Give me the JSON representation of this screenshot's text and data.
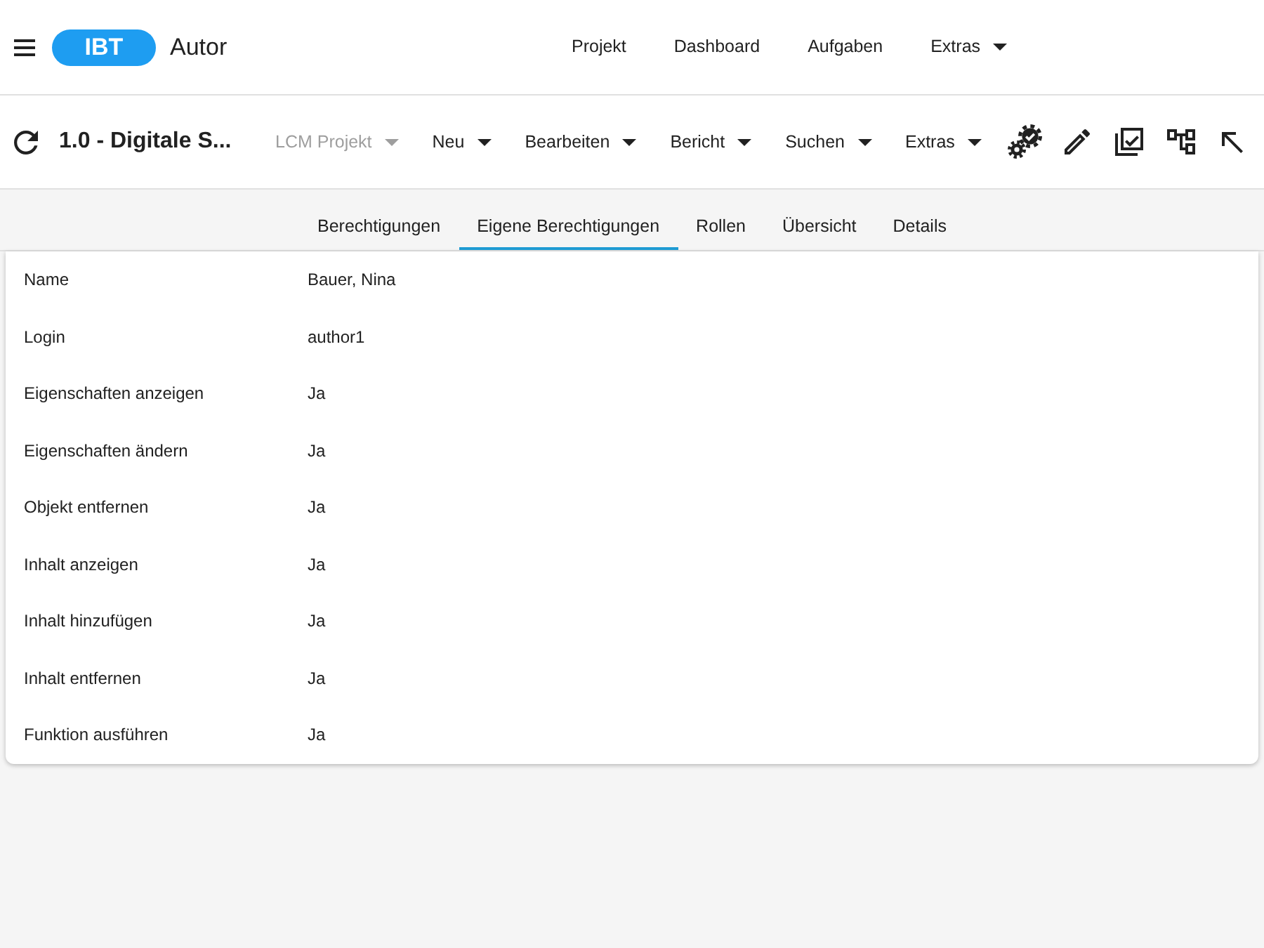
{
  "header": {
    "logo": "IBT",
    "app_title": "Autor",
    "nav": [
      {
        "label": "Projekt",
        "dropdown": false
      },
      {
        "label": "Dashboard",
        "dropdown": false
      },
      {
        "label": "Aufgaben",
        "dropdown": false
      },
      {
        "label": "Extras",
        "dropdown": true
      }
    ]
  },
  "toolbar": {
    "title": "1.0 - Digitale S...",
    "menus": [
      {
        "label": "LCM Projekt",
        "disabled": true
      },
      {
        "label": "Neu",
        "disabled": false
      },
      {
        "label": "Bearbeiten",
        "disabled": false
      },
      {
        "label": "Bericht",
        "disabled": false
      },
      {
        "label": "Suchen",
        "disabled": false
      },
      {
        "label": "Extras",
        "disabled": false
      }
    ]
  },
  "tabs": [
    {
      "label": "Berechtigungen",
      "selected": false
    },
    {
      "label": "Eigene Berechtigungen",
      "selected": true
    },
    {
      "label": "Rollen",
      "selected": false
    },
    {
      "label": "Übersicht",
      "selected": false
    },
    {
      "label": "Details",
      "selected": false
    }
  ],
  "properties": [
    {
      "label": "Name",
      "value": "Bauer, Nina"
    },
    {
      "label": "Login",
      "value": "author1"
    },
    {
      "label": "Eigenschaften anzeigen",
      "value": "Ja"
    },
    {
      "label": "Eigenschaften ändern",
      "value": "Ja"
    },
    {
      "label": "Objekt entfernen",
      "value": "Ja"
    },
    {
      "label": "Inhalt anzeigen",
      "value": "Ja"
    },
    {
      "label": "Inhalt hinzufügen",
      "value": "Ja"
    },
    {
      "label": "Inhalt entfernen",
      "value": "Ja"
    },
    {
      "label": "Funktion ausführen",
      "value": "Ja"
    }
  ]
}
